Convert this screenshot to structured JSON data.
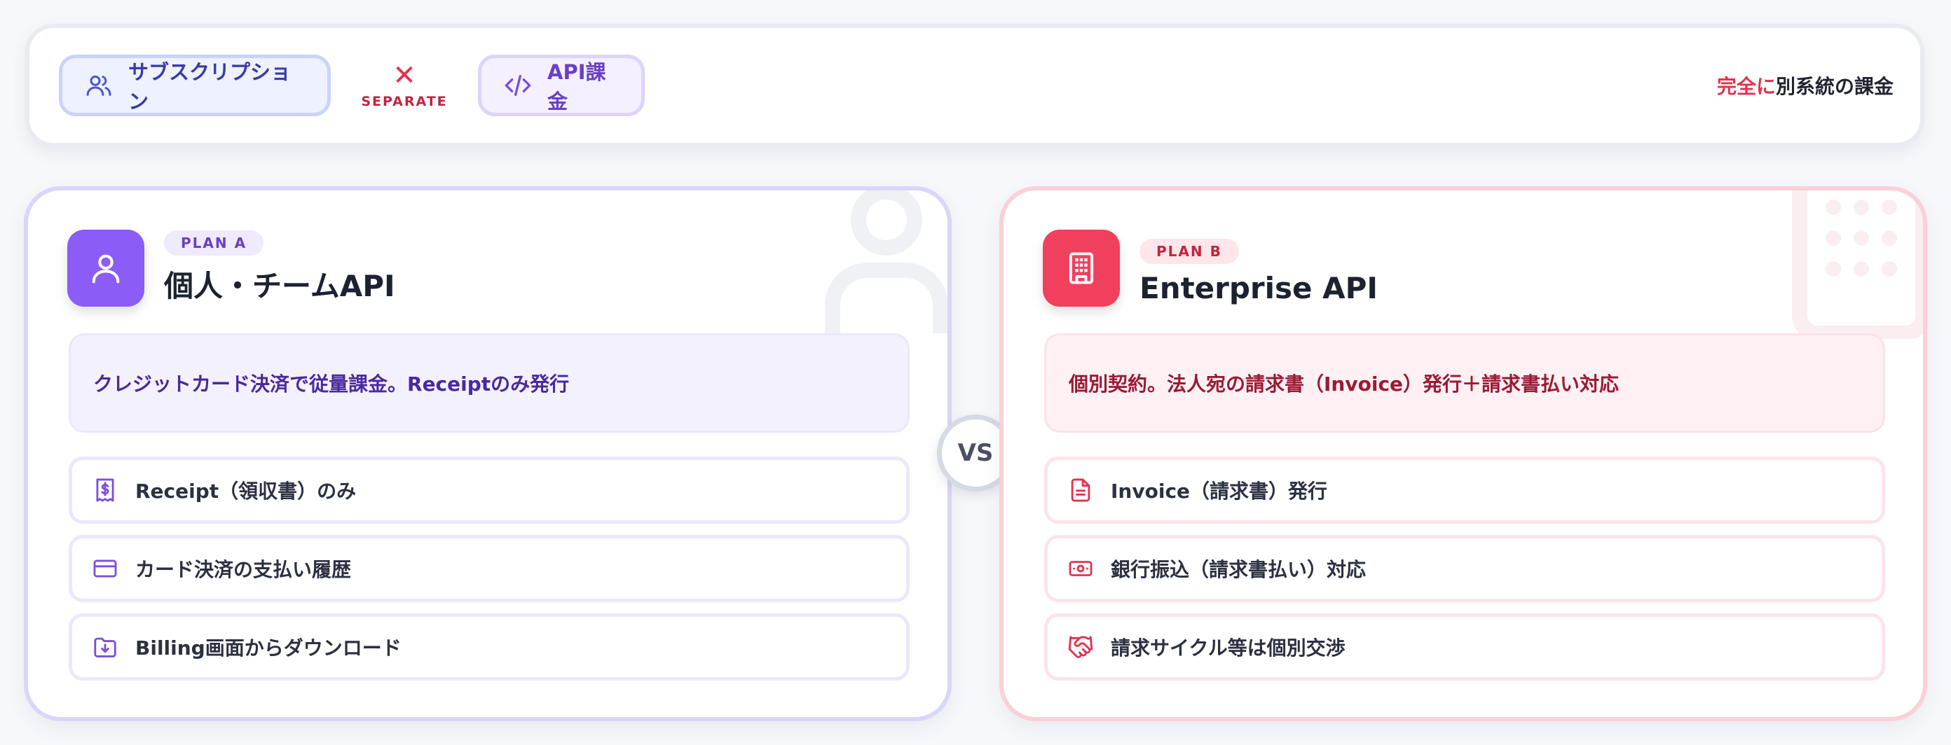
{
  "header": {
    "subscription_label": "サブスクリプション",
    "separator_label": "SEPARATE",
    "api_label": "API課金",
    "note_highlight": "完全に",
    "note_rest": "別系統の課金"
  },
  "plan_a": {
    "badge": "PLAN A",
    "title": "個人・チームAPI",
    "description": "クレジットカード決済で従量課金。Receiptのみ発行",
    "features": [
      {
        "label": "Receipt（領収書）のみ",
        "icon": "receipt-icon"
      },
      {
        "label": "カード決済の支払い履歴",
        "icon": "credit-card-icon"
      },
      {
        "label": "Billing画面からダウンロード",
        "icon": "folder-download-icon"
      }
    ],
    "icon": "user-icon"
  },
  "plan_b": {
    "badge": "PLAN B",
    "title": "Enterprise API",
    "description": "個別契約。法人宛の請求書（Invoice）発行＋請求書払い対応",
    "features": [
      {
        "label": "Invoice（請求書）発行",
        "icon": "document-icon"
      },
      {
        "label": "銀行振込（請求書払い）対応",
        "icon": "banknote-icon"
      },
      {
        "label": "請求サイクル等は個別交渉",
        "icon": "handshake-icon"
      }
    ],
    "icon": "building-icon"
  },
  "vs_label": "VS",
  "colors": {
    "plan_a_accent": "#8b5cf6",
    "plan_b_accent": "#f0405d",
    "separator": "#e0334e"
  }
}
